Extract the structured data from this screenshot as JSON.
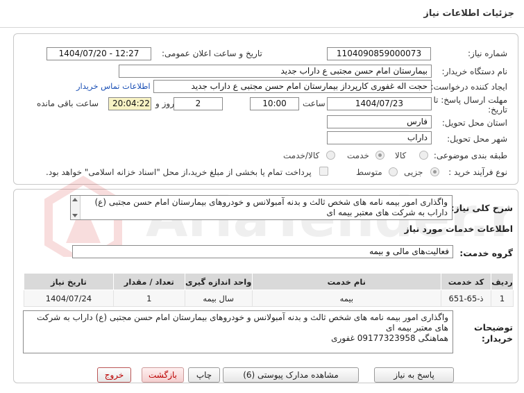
{
  "header": {
    "title": "جزئیات اطلاعات نیاز"
  },
  "form": {
    "need_number_label": "شماره نیاز:",
    "need_number": "1104090859000073",
    "announce_label": "تاریخ و ساعت اعلان عمومی:",
    "announce_value": "1404/07/20 - 12:27",
    "buyer_org_label": "نام دستگاه خریدار:",
    "buyer_org": "بیمارستان امام حسن مجتبی  ع  داراب جدید",
    "requester_label": "ایجاد کننده درخواست:",
    "requester": "حجت اله غفوری کارپرداز بیمارستان امام حسن مجتبی  ع  داراب جدید",
    "contact_link": "اطلاعات تماس خریدار",
    "deadline_label_1": "مهلت ارسال پاسخ: تا",
    "deadline_label_2": "تاریخ:",
    "deadline_date": "1404/07/23",
    "time_label": "ساعت",
    "deadline_time": "10:00",
    "days_value": "2",
    "days_label": "روز و",
    "remaining_time": "20:04:22",
    "remaining_label": "ساعت باقی مانده",
    "province_label": "استان محل تحویل:",
    "province": "فارس",
    "city_label": "شهر محل تحویل:",
    "city": "داراب",
    "category_label": "طبقه بندی موضوعی:",
    "category_options": [
      "کالا",
      "خدمت",
      "کالا/خدمت"
    ],
    "category_selected": "خدمت",
    "process_label": "نوع فرآیند خرید :",
    "process_options": [
      "جزیی",
      "متوسط"
    ],
    "process_selected": "جزیی",
    "payment_note": "پرداخت تمام یا بخشی از مبلغ خرید،از محل \"اسناد خزانه اسلامی\" خواهد بود."
  },
  "description": {
    "label": "شرح کلی نیاز:",
    "text_line1": "واگذاری امور بیمه نامه های شخص ثالث و بدنه آمبولانس و خودروهای بیمارستان امام حسن مجتبی (ع)",
    "text_line2": "داراب به شرکت های معتبر بیمه ای"
  },
  "services": {
    "section_title": "اطلاعات خدمات مورد نیاز",
    "group_label": "گروه خدمت:",
    "group_value": "فعالیت‌های مالی و بیمه",
    "columns": [
      "ردیف",
      "کد خدمت",
      "نام خدمت",
      "واحد اندازه گیری",
      "تعداد / مقدار",
      "تاریخ نیاز"
    ],
    "rows": [
      [
        "1",
        "ذ-65-651",
        "بیمه",
        "سال بیمه",
        "1",
        "1404/07/24"
      ]
    ]
  },
  "buyer_notes": {
    "label_1": "توضیحات",
    "label_2": "خریدار:",
    "line1": "واگذاری امور بیمه نامه های شخص ثالث و بدنه آمبولانس و خودروهای بیمارستان امام حسن مجتبی (ع) داراب به شرکت",
    "line2": "های معتبر بیمه ای",
    "line3": "هماهنگی 09177323958 غفوری"
  },
  "buttons": {
    "reply": "پاسخ به نیاز",
    "attachments": "مشاهده مدارک پیوستی (6)",
    "print": "چاپ",
    "back": "بازگشت",
    "exit": "خروج"
  },
  "watermark": {
    "text": "AriaTender.net"
  },
  "colors": {
    "remaining_bg": "#f8f3c4",
    "link": "#1a4fb5",
    "table_header": "#d9d9d9"
  }
}
